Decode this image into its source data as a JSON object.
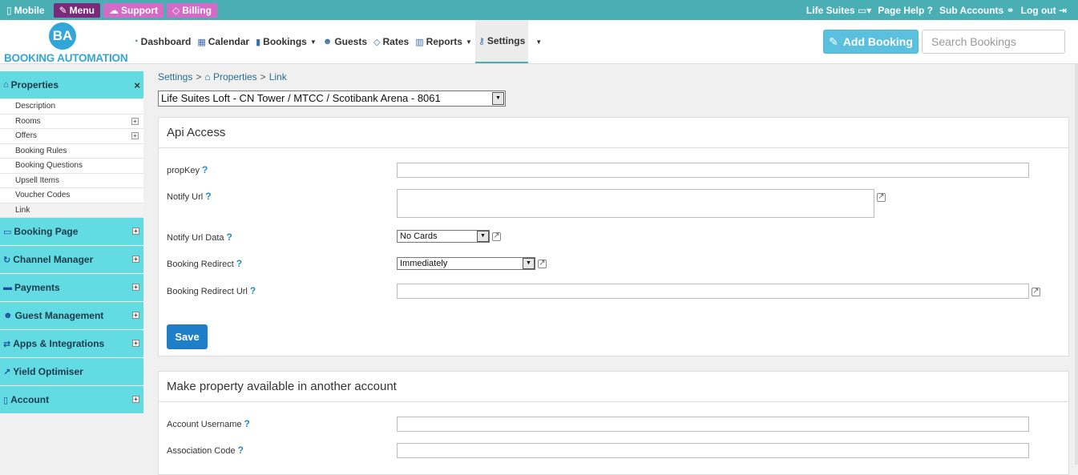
{
  "topbar": {
    "mobile": "Mobile",
    "menu": "Menu",
    "support": "Support",
    "billing": "Billing",
    "right": [
      "Life Suites",
      "Page Help ?",
      "Sub Accounts",
      "Log out"
    ]
  },
  "logo": {
    "initials": "BA",
    "text": "BOOKING AUTOMATION"
  },
  "nav": {
    "dashboard": "Dashboard",
    "calendar": "Calendar",
    "bookings": "Bookings",
    "guests": "Guests",
    "rates": "Rates",
    "reports": "Reports",
    "settings": "Settings"
  },
  "header": {
    "add_booking": "Add Booking",
    "search_placeholder": "Search Bookings"
  },
  "sidebar": {
    "properties": "Properties",
    "items": [
      "Description",
      "Rooms",
      "Offers",
      "Booking Rules",
      "Booking Questions",
      "Upsell Items",
      "Voucher Codes",
      "Link"
    ],
    "sections": [
      "Booking Page",
      "Channel Manager",
      "Payments",
      "Guest Management",
      "Apps & Integrations",
      "Yield Optimiser",
      "Account"
    ]
  },
  "breadcrumb": {
    "a": "Settings",
    "b": "Properties",
    "c": "Link",
    "sep": ">"
  },
  "property_select": "Life Suites Loft - CN Tower / MTCC / Scotibank Arena - 8061",
  "api": {
    "title": "Api Access",
    "propkey": "propKey",
    "notify_url": "Notify Url",
    "notify_url_data": "Notify Url Data",
    "notify_url_data_value": "No Cards",
    "booking_redirect": "Booking Redirect",
    "booking_redirect_value": "Immediately",
    "booking_redirect_url": "Booking Redirect Url",
    "save": "Save"
  },
  "share": {
    "title": "Make property available in another account",
    "account_username": "Account Username",
    "association_code": "Association Code"
  },
  "help_mark": "?"
}
